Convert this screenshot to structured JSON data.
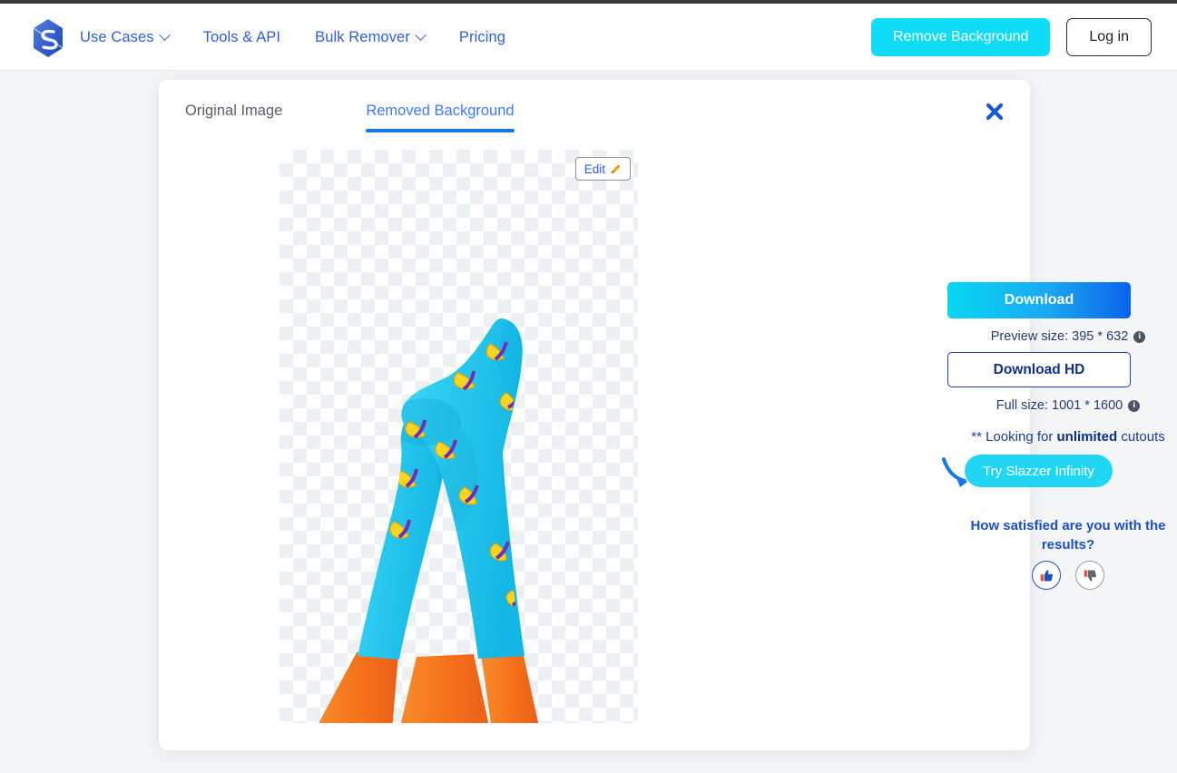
{
  "brand": {
    "logo_icon": "slazzer-logo-icon",
    "accent_cyan": "#0fdcf7",
    "accent_blue": "#2f5fd0"
  },
  "header": {
    "nav": [
      {
        "label": "Use Cases",
        "has_chevron": true
      },
      {
        "label": "Tools & API",
        "has_chevron": false
      },
      {
        "label": "Bulk Remover",
        "has_chevron": true
      },
      {
        "label": "Pricing",
        "has_chevron": false
      }
    ],
    "remove_background_label": "Remove Background",
    "login_label": "Log in"
  },
  "card": {
    "tabs": [
      {
        "label": "Original Image",
        "active": false
      },
      {
        "label": "Removed Background",
        "active": true
      }
    ],
    "close_icon": "close-icon",
    "viewport": {
      "edit_label": "Edit",
      "edit_icon": "pencil-icon",
      "subject_description": "cyan socks with yellow banana print on orange cones",
      "background": "transparency-checkerboard"
    },
    "panel": {
      "download_label": "Download",
      "preview_size_label": "Preview size: 395 * 632",
      "download_hd_label": "Download HD",
      "full_size_label": "Full size: 1001 * 1600",
      "info_icon_glyph": "i",
      "unlimited_prefix": "** Looking for ",
      "unlimited_bold": "unlimited",
      "unlimited_suffix": " cutouts",
      "infinity_label": "Try Slazzer Infinity",
      "satisfied_question": "How satisfied are you with the results?",
      "thumbs_up_icon": "thumbs-up-icon",
      "thumbs_down_icon": "thumbs-down-icon"
    }
  }
}
